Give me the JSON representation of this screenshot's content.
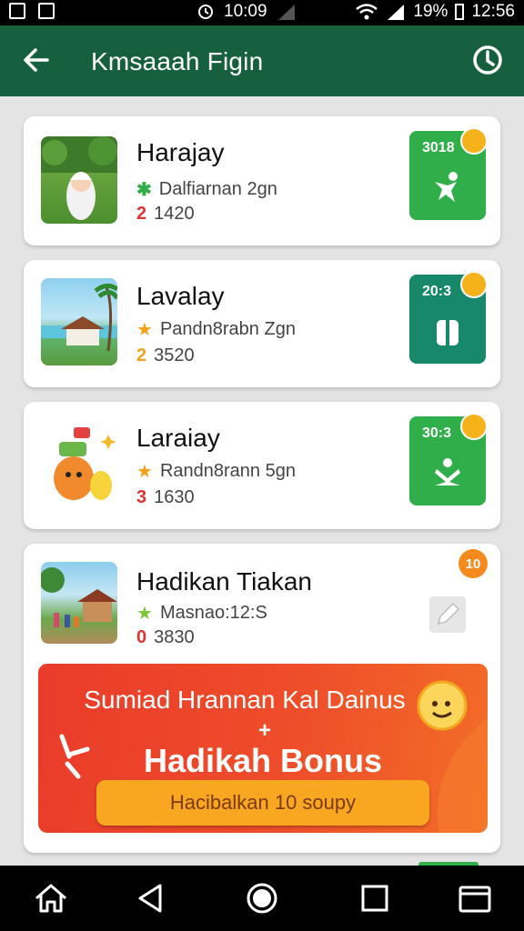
{
  "status_bar": {
    "time_left": "10:09",
    "battery": "19%",
    "time_right": "12:56"
  },
  "app_bar": {
    "title": "Kmsaaah Figin"
  },
  "cards": [
    {
      "title": "Harajay",
      "line1": "Dalfiarnan 2gn",
      "line2": "1420",
      "badge_num": "3018",
      "badge_color": "#2fae4a"
    },
    {
      "title": "Lavalay",
      "line1": "Pandn8rabn Zgn",
      "line2": "3520",
      "badge_num": "20:3",
      "badge_color": "#17896a"
    },
    {
      "title": "Laraiay",
      "line1": "Randn8rann 5gn",
      "line2": "1630",
      "badge_num": "30:3",
      "badge_color": "#2fae4a"
    },
    {
      "title": "Hadikan Tiakan",
      "line1": "Masnao:12:S",
      "line2": "3830",
      "badge_num": "10"
    }
  ],
  "promo": {
    "headline": "Sumiad Hrannan Kal Dainus",
    "plus": "+",
    "bonus_title": "Hadikah Bonus",
    "button_label": "Hacibalkan 10 soupy"
  },
  "colors": {
    "app_bar": "#17603e",
    "promo": "#ee4d2a",
    "promo_button": "#f9a620"
  }
}
